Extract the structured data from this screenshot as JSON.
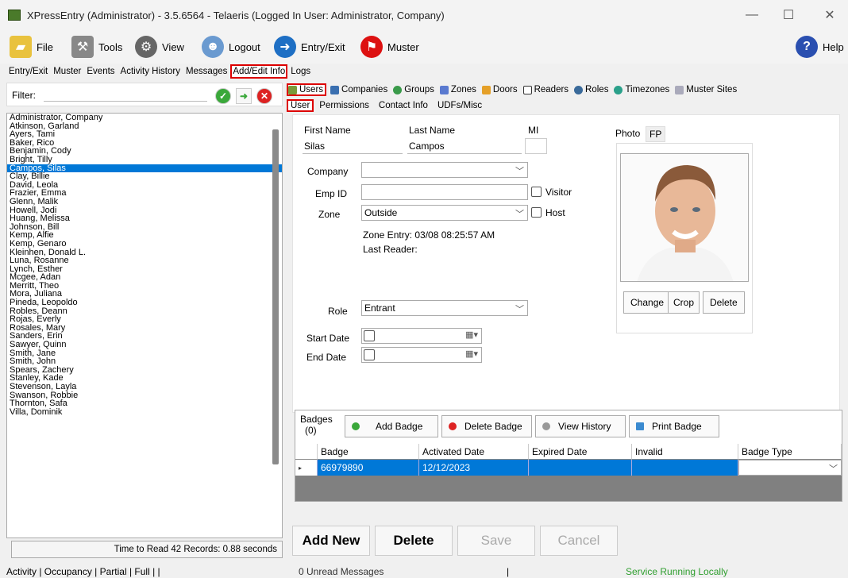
{
  "window": {
    "title": "XPressEntry (Administrator) - 3.5.6564 - Telaeris (Logged In User: Administrator, Company)",
    "minimize": "—",
    "maximize": "☐",
    "close": "✕"
  },
  "toolbar": {
    "file": "File",
    "tools": "Tools",
    "view": "View",
    "logout": "Logout",
    "entry_exit": "Entry/Exit",
    "muster": "Muster",
    "help": "Help"
  },
  "nav_tabs": [
    "Entry/Exit",
    "Muster",
    "Events",
    "Activity History",
    "Messages",
    "Add/Edit Info",
    "Logs"
  ],
  "filter": {
    "label": "Filter:",
    "value": ""
  },
  "users": [
    "Administrator, Company",
    "Atkinson, Garland",
    "Ayers, Tami",
    "Baker, Rico",
    "Benjamin, Cody",
    "Bright, Tilly",
    "Campos, Silas",
    "Clay, Billie",
    "David, Leola",
    "Frazier, Emma",
    "Glenn, Malik",
    "Howell, Jodi",
    "Huang, Melissa",
    "Johnson, Bill",
    "Kemp, Alfie",
    "Kemp, Genaro",
    "Kleinhen, Donald L.",
    "Luna, Rosanne",
    "Lynch, Esther",
    "Mcgee, Adan",
    "Merritt, Theo",
    "Mora, Juliana",
    "Pineda, Leopoldo",
    "Robles, Deann",
    "Rojas, Everly",
    "Rosales, Mary",
    "Sanders, Erin",
    "Sawyer, Quinn",
    "Smith, Jane",
    "Smith, John",
    "Spears, Zachery",
    "Stanley, Kade",
    "Stevenson, Layla",
    "Swanson, Robbie",
    "Thornton, Safa",
    "Villa, Dominik"
  ],
  "selected_user": "Campos, Silas",
  "read_status": "Time to Read 42 Records: 0.88 seconds",
  "entity_tabs": [
    "Users",
    "Companies",
    "Groups",
    "Zones",
    "Doors",
    "Readers",
    "Roles",
    "Timezones",
    "Muster Sites"
  ],
  "user_tabs": [
    "User",
    "Permissions",
    "Contact Info",
    "UDFs/Misc"
  ],
  "form": {
    "first_name_label": "First Name",
    "last_name_label": "Last Name",
    "mi_label": "MI",
    "first_name": "Silas",
    "last_name": "Campos",
    "mi": "",
    "company_label": "Company",
    "company": "",
    "emp_id_label": "Emp ID",
    "emp_id": "",
    "visitor_label": "Visitor",
    "zone_label": "Zone",
    "zone": "Outside",
    "host_label": "Host",
    "zone_entry": "Zone Entry: 03/08 08:25:57 AM",
    "last_reader": "Last Reader:",
    "role_label": "Role",
    "role": "Entrant",
    "start_date_label": "Start Date",
    "end_date_label": "End Date"
  },
  "photo": {
    "tab_photo": "Photo",
    "tab_fp": "FP",
    "change": "Change",
    "crop": "Crop",
    "delete": "Delete"
  },
  "badges": {
    "label": "Badges",
    "count": "(0)",
    "add": "Add Badge",
    "delete": "Delete Badge",
    "history": "View History",
    "print": "Print Badge",
    "columns": [
      "Badge",
      "Activated Date",
      "Expired Date",
      "Invalid",
      "Badge Type"
    ],
    "rows": [
      {
        "badge": "66979890",
        "activated": "12/12/2023",
        "expired": "",
        "invalid": "",
        "type": ""
      }
    ]
  },
  "actions": {
    "add_new": "Add New",
    "delete": "Delete",
    "save": "Save",
    "cancel": "Cancel"
  },
  "status": {
    "tabs": "Activity | Occupancy | Partial | Full | |",
    "messages": "0 Unread Messages",
    "sep": "|",
    "service": "Service Running Locally"
  },
  "colors": {
    "selection": "#0078d7",
    "highlight": "#d00000",
    "service": "#2e9e2e"
  }
}
